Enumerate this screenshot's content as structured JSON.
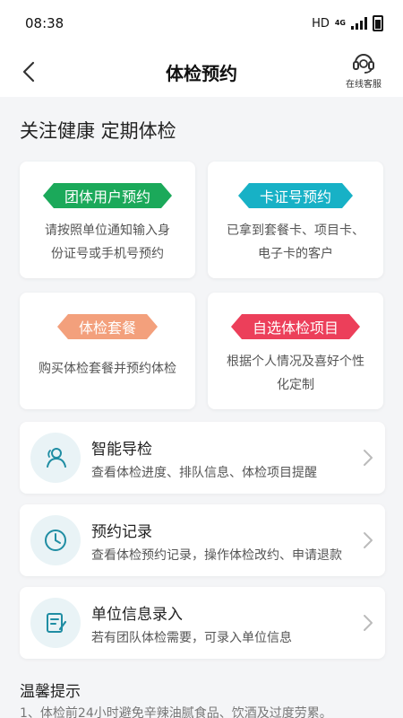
{
  "status": {
    "time": "08:38",
    "hd": "HD",
    "net": "4G"
  },
  "header": {
    "title": "体检预约",
    "service_label": "在线客服"
  },
  "slogan": "关注健康 定期体检",
  "cards": [
    {
      "tag": "团体用户预约",
      "desc_line1": "请按照单位通知输入身",
      "desc_line2": "份证号或手机号预约",
      "color": "#1ba95a"
    },
    {
      "tag": "卡证号预约",
      "desc_line1": "已拿到套餐卡、项目卡、",
      "desc_line2": "电子卡的客户",
      "color": "#17b1c6"
    },
    {
      "tag": "体检套餐",
      "desc_line1": "购买体检套餐并预约体检",
      "desc_line2": "",
      "color": "#f3a07c"
    },
    {
      "tag": "自选体检项目",
      "desc_line1": "根据个人情况及喜好个性",
      "desc_line2": "化定制",
      "color": "#ec3f5a"
    }
  ],
  "rows": [
    {
      "title": "智能导检",
      "desc": "查看体检进度、排队信息、体检项目提醒",
      "icon": "users-icon"
    },
    {
      "title": "预约记录",
      "desc": "查看体检预约记录，操作体检改约、申请退款",
      "icon": "clock-icon"
    },
    {
      "title": "单位信息录入",
      "desc": "若有团队体检需要，可录入单位信息",
      "icon": "edit-form-icon"
    }
  ],
  "tips": {
    "title": "温馨提示",
    "item1": "1、体检前24小时避免辛辣油腻食品、饮酒及过度劳累。"
  },
  "colors": {
    "accent": "#17a2b8",
    "icon_bg": "#e9f3f6"
  }
}
